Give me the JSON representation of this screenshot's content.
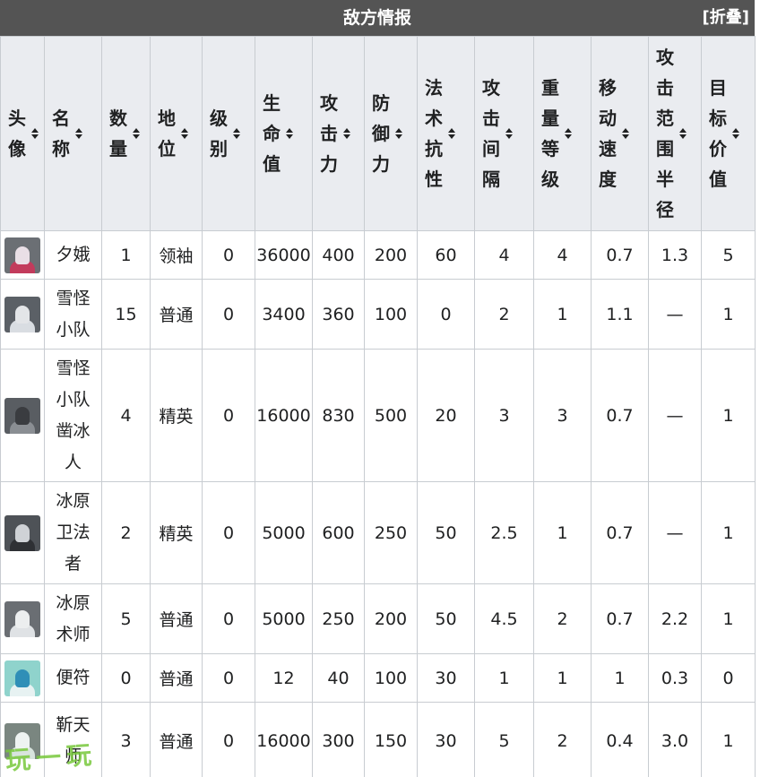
{
  "header": {
    "title": "敌方情报",
    "collapse_label": "[折叠]"
  },
  "columns": [
    {
      "key": "avatar",
      "label": "头像"
    },
    {
      "key": "name",
      "label": "名称"
    },
    {
      "key": "count",
      "label": "数量"
    },
    {
      "key": "status",
      "label": "地位"
    },
    {
      "key": "level",
      "label": "级别"
    },
    {
      "key": "hp",
      "label": "生命值"
    },
    {
      "key": "atk",
      "label": "攻击力"
    },
    {
      "key": "def",
      "label": "防御力"
    },
    {
      "key": "res",
      "label": "法术抗性"
    },
    {
      "key": "interval",
      "label": "攻击间隔"
    },
    {
      "key": "weight",
      "label": "重量等级"
    },
    {
      "key": "speed",
      "label": "移动速度"
    },
    {
      "key": "range",
      "label": "攻击范围半径"
    },
    {
      "key": "target",
      "label": "目标价值"
    }
  ],
  "rows": [
    {
      "avatar": "xi-avatar-icon",
      "name": "夕娥",
      "count": "1",
      "status": "领袖",
      "level": "0",
      "hp": "36000",
      "atk": "400",
      "def": "200",
      "res": "60",
      "interval": "4",
      "weight": "4",
      "speed": "0.7",
      "range": "1.3",
      "target": "5"
    },
    {
      "avatar": "snow-squad-avatar-icon",
      "name": "雪怪小队",
      "count": "15",
      "status": "普通",
      "level": "0",
      "hp": "3400",
      "atk": "360",
      "def": "100",
      "res": "0",
      "interval": "2",
      "weight": "1",
      "speed": "1.1",
      "range": "—",
      "target": "1"
    },
    {
      "avatar": "ice-chisel-avatar-icon",
      "name": "雪怪小队凿冰人",
      "count": "4",
      "status": "精英",
      "level": "0",
      "hp": "16000",
      "atk": "830",
      "def": "500",
      "res": "20",
      "interval": "3",
      "weight": "3",
      "speed": "0.7",
      "range": "—",
      "target": "1"
    },
    {
      "avatar": "icefield-guard-avatar-icon",
      "name": "冰原卫法者",
      "count": "2",
      "status": "精英",
      "level": "0",
      "hp": "5000",
      "atk": "600",
      "def": "250",
      "res": "50",
      "interval": "2.5",
      "weight": "1",
      "speed": "0.7",
      "range": "—",
      "target": "1"
    },
    {
      "avatar": "icefield-caster-avatar-icon",
      "name": "冰原术师",
      "count": "5",
      "status": "普通",
      "level": "0",
      "hp": "5000",
      "atk": "250",
      "def": "200",
      "res": "50",
      "interval": "4.5",
      "weight": "2",
      "speed": "0.7",
      "range": "2.2",
      "target": "1"
    },
    {
      "avatar": "talisman-avatar-icon",
      "name": "便符",
      "count": "0",
      "status": "普通",
      "level": "0",
      "hp": "12",
      "atk": "40",
      "def": "100",
      "res": "30",
      "interval": "1",
      "weight": "1",
      "speed": "1",
      "range": "0.3",
      "target": "0"
    },
    {
      "avatar": "sky-master-avatar-icon",
      "name": "靳天师",
      "count": "3",
      "status": "普通",
      "level": "0",
      "hp": "16000",
      "atk": "300",
      "def": "150",
      "res": "30",
      "interval": "5",
      "weight": "2",
      "speed": "0.4",
      "range": "3.0",
      "target": "1"
    }
  ],
  "avatar_colors": [
    {
      "bg": "#6b6f74",
      "face": "#e9dfe6",
      "body": "#c23b5c"
    },
    {
      "bg": "#5b6066",
      "face": "#e3e5e8",
      "body": "#d9dde2"
    },
    {
      "bg": "#595d62",
      "face": "#3a3c40",
      "body": "#8a8e93"
    },
    {
      "bg": "#4e5257",
      "face": "#cfd2d6",
      "body": "#2e3034"
    },
    {
      "bg": "#6a6e73",
      "face": "#eceeef",
      "body": "#dfe2e5"
    },
    {
      "bg": "#8fd3cc",
      "face": "#2f8fb7",
      "body": "#e7f2f2"
    },
    {
      "bg": "#7a8680",
      "face": "#eef3f1",
      "body": "#d8e4de"
    }
  ],
  "watermark": "玩一玩"
}
